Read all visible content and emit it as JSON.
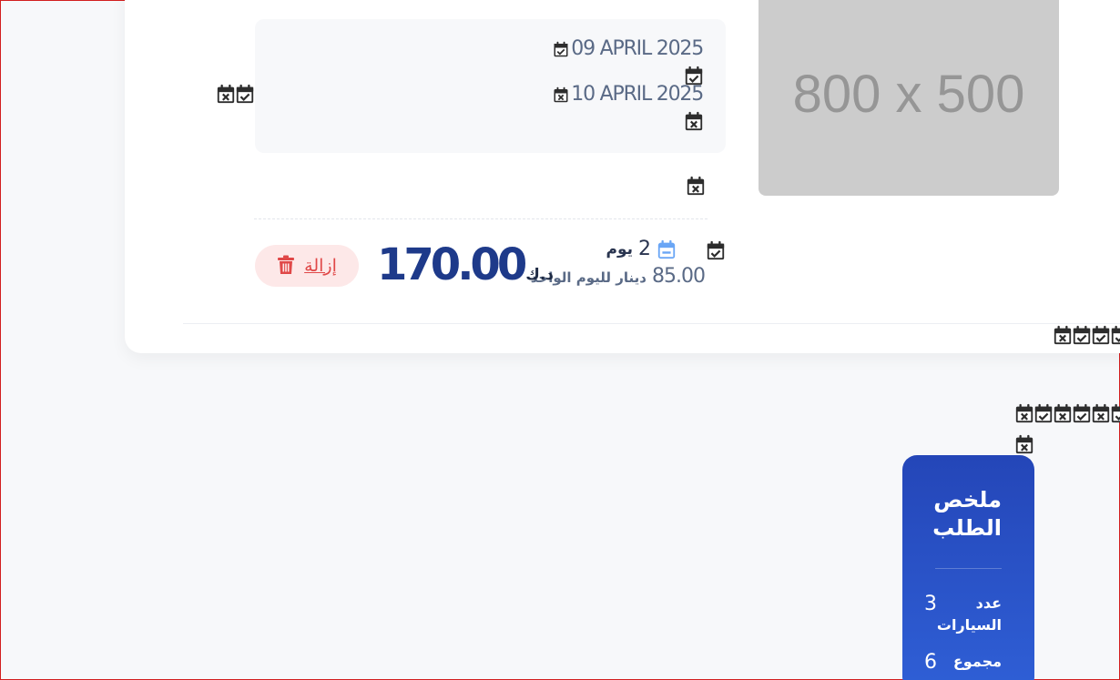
{
  "cart_item": {
    "image_placeholder": "800 x 500",
    "pickup_date": "09 APRIL 2025",
    "return_date": "10 APRIL 2025",
    "days_count": "2",
    "days_unit": "يوم",
    "per_day_price": "85.00",
    "per_day_label": "دينار لليوم الواحد",
    "total_price": "170.00",
    "currency": "د.ك",
    "remove_label": "إزالة"
  },
  "summary": {
    "title": "ملخص الطلب",
    "cars_label": "عدد السيارات",
    "cars_value": "3",
    "total_label": "مجموع",
    "total_value": "6"
  },
  "colors": {
    "primary": "#1e3a8a",
    "summary_bg": "#2446b8",
    "danger": "#e04848",
    "danger_bg": "#fde8e8",
    "muted_text": "#5a6a86"
  },
  "icons": [
    "calendar-check-icon",
    "calendar-x-icon",
    "calendar-minus-icon",
    "trash-icon"
  ]
}
